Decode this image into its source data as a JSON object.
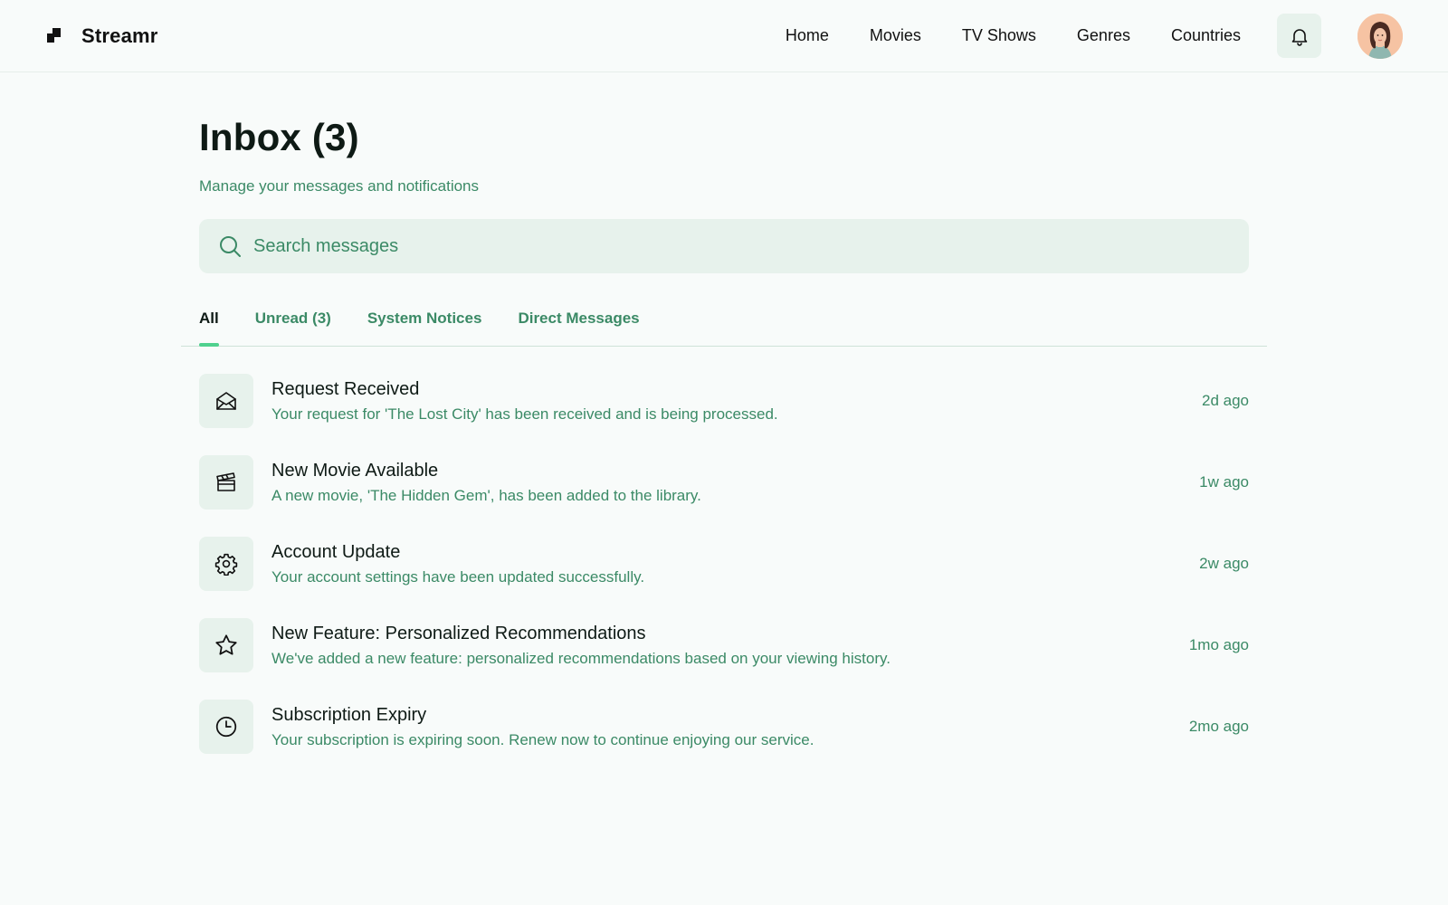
{
  "header": {
    "brand": "Streamr",
    "nav": [
      "Home",
      "Movies",
      "TV Shows",
      "Genres",
      "Countries"
    ],
    "bell_icon": "bell-icon",
    "avatar": "user-avatar"
  },
  "page": {
    "title": "Inbox (3)",
    "subtitle": "Manage your messages and notifications"
  },
  "search": {
    "placeholder": "Search messages",
    "icon": "search-icon"
  },
  "tabs": [
    {
      "label": "All",
      "active": true
    },
    {
      "label": "Unread (3)",
      "active": false
    },
    {
      "label": "System Notices",
      "active": false
    },
    {
      "label": "Direct Messages",
      "active": false
    }
  ],
  "messages": [
    {
      "icon": "envelope-open-icon",
      "title": "Request Received",
      "description": "Your request for 'The Lost City' has been received and is being processed.",
      "time": "2d ago"
    },
    {
      "icon": "clapperboard-icon",
      "title": "New Movie Available",
      "description": "A new movie, 'The Hidden Gem', has been added to the library.",
      "time": "1w ago"
    },
    {
      "icon": "gear-icon",
      "title": "Account Update",
      "description": "Your account settings have been updated successfully.",
      "time": "2w ago"
    },
    {
      "icon": "star-icon",
      "title": "New Feature: Personalized Recommendations",
      "description": "We've added a new feature: personalized recommendations based on your viewing history.",
      "time": "1mo ago"
    },
    {
      "icon": "clock-icon",
      "title": "Subscription Expiry",
      "description": "Your subscription is expiring soon. Renew now to continue enjoying our service.",
      "time": "2mo ago"
    }
  ],
  "colors": {
    "accent": "#4fd18e",
    "muted_text": "#3b8a66",
    "chip_bg": "#e7f2ec",
    "background": "#f8fbfa"
  }
}
